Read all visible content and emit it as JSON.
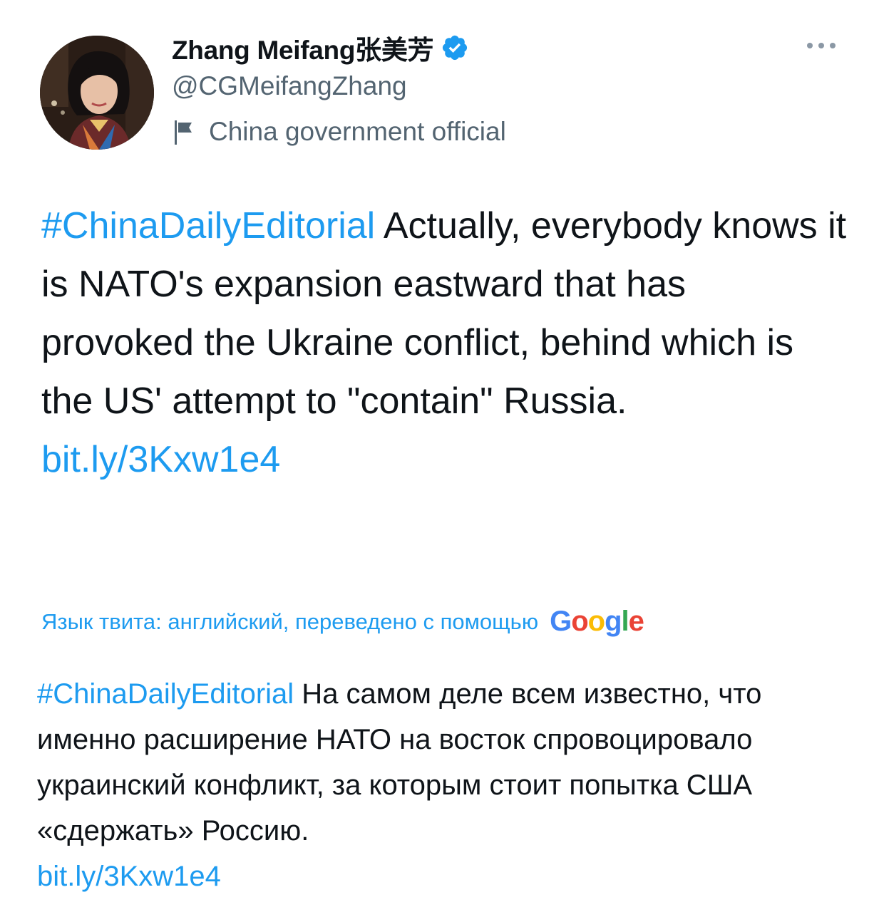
{
  "author": {
    "display_name": "Zhang Meifang张美芳",
    "handle": "@CGMeifangZhang",
    "label": "China government official",
    "verified_icon": "verified-badge-icon",
    "label_icon": "flag-icon"
  },
  "more_icon": "more-options-icon",
  "tweet": {
    "hashtag": "#ChinaDailyEditorial",
    "text": " Actually, everybody knows it is NATO's expansion eastward that has provoked the Ukraine conflict, behind which is the US' attempt to \"contain\" Russia.",
    "link": "bit.ly/3Kxw1e4"
  },
  "translation": {
    "notice": "Язык твита: английский, переведено с помощью",
    "provider": "Google",
    "hashtag": "#ChinaDailyEditorial",
    "text": " На самом деле всем известно, что именно расширение НАТО на восток спровоцировало украинский конфликт, за которым стоит попытка США «сдержать» Россию.",
    "link": "bit.ly/3Kxw1e4"
  },
  "colors": {
    "link": "#1d9bf0",
    "text": "#0f1419",
    "secondary": "#536471",
    "verified": "#1d9bf0"
  }
}
